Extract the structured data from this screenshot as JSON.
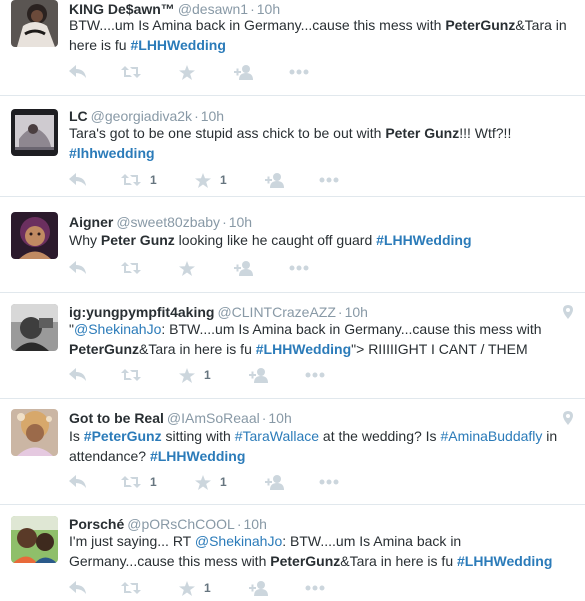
{
  "colors": {
    "link": "#2b7bb9",
    "muted": "#8899a6",
    "icon": "#ccd6dd",
    "border": "#e1e8ed",
    "text": "#292f33"
  },
  "tweets": [
    {
      "fullname": "KING De$awn™",
      "username": "@desawn1",
      "time": "10h",
      "text": [
        "BTW....um Is Amina back in Germany...cause this mess with ",
        "PeterGunz",
        "&Tara in here is fu ",
        "#LHHWedding"
      ],
      "retweets": "",
      "favorites": "",
      "geo": false
    },
    {
      "fullname": "LC",
      "username": "@georgiadiva2k",
      "time": "10h",
      "text": [
        "Tara's got to be one stupid ass chick to be out with ",
        "Peter Gunz",
        "!!! Wtf?!! ",
        "#lhhwedding"
      ],
      "retweets": "1",
      "favorites": "1",
      "geo": false
    },
    {
      "fullname": "Aigner",
      "username": "@sweet80zbaby",
      "time": "10h",
      "text": [
        "Why ",
        "Peter Gunz",
        " looking like he caught off guard ",
        "#LHHWedding"
      ],
      "retweets": "",
      "favorites": "",
      "geo": false
    },
    {
      "fullname": "ig:yungpympfit4aking",
      "username": "@CLINTCrazeAZZ",
      "time": "10h",
      "text": [
        "\"",
        "@ShekinahJo",
        ": BTW....um Is Amina back in Germany...cause this mess with ",
        "PeterGunz",
        "&Tara in here is fu ",
        "#LHHWedding",
        "\"> RIIIIIGHT I CANT / THEM"
      ],
      "retweets": "",
      "favorites": "1",
      "geo": true
    },
    {
      "fullname": "Got to be Real",
      "username": "@IAmSoReaal",
      "time": "10h",
      "text": [
        "Is ",
        "#PeterGunz",
        " sitting with ",
        "#TaraWallace",
        " at the wedding? Is ",
        "#AminaBuddafly",
        " in attendance? ",
        "#LHHWedding"
      ],
      "retweets": "1",
      "favorites": "1",
      "geo": true
    },
    {
      "fullname": "Porsché",
      "username": "@pORsChCOOL",
      "time": "10h",
      "text": [
        "I'm just saying... RT ",
        "@ShekinahJo",
        ": BTW....um Is Amina back in Germany...cause this mess with ",
        "PeterGunz",
        "&Tara in here is fu ",
        "#LHHWedding"
      ],
      "retweets": "",
      "favorites": "1",
      "geo": false
    }
  ]
}
